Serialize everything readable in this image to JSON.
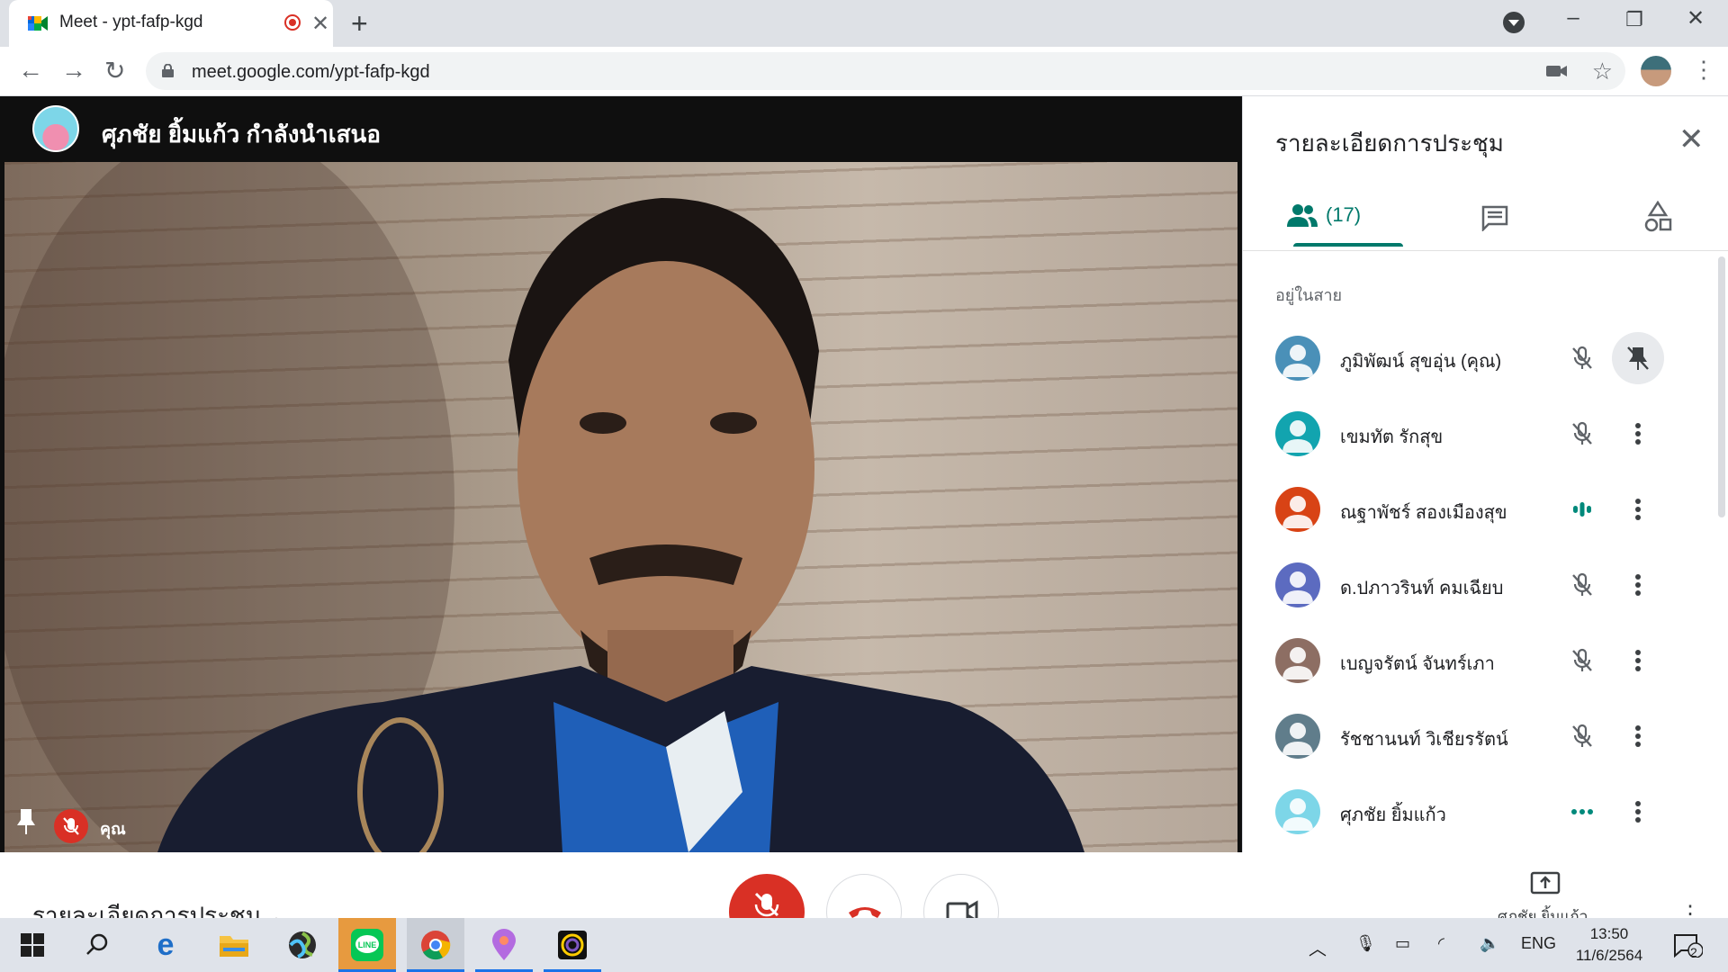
{
  "browser": {
    "tab_title": "Meet - ypt-fafp-kgd",
    "url": "meet.google.com/ypt-fafp-kgd"
  },
  "stage": {
    "presenter_title": "ศุภชัย ยิ้มแก้ว กำลังนำเสนอ",
    "self_label": "คุณ"
  },
  "panel": {
    "title": "รายละเอียดการประชุม",
    "people_count": "(17)",
    "section_label": "อยู่ในสาย",
    "participants": [
      {
        "name": "ภูมิพัฒน์ สุขอุ่น (คุณ)",
        "avatar_color": "#4a90b8",
        "mic": "muted",
        "action": "pinned"
      },
      {
        "name": "เขมทัต รักสุข",
        "avatar_color": "#12a4af",
        "mic": "muted",
        "action": "more"
      },
      {
        "name": "ณฐาพัชร์ สองเมืองสุข",
        "avatar_color": "#d84315",
        "mic": "speaking",
        "action": "more"
      },
      {
        "name": "ด.ปภาวรินท์ คมเฉียบ",
        "avatar_color": "#5c6bc0",
        "mic": "muted",
        "action": "more"
      },
      {
        "name": "เบญจรัตน์ จันทร์เภา",
        "avatar_color": "#8d6e63",
        "mic": "muted",
        "action": "more"
      },
      {
        "name": "รัชชานนท์ วิเชียรรัตน์",
        "avatar_color": "#607d8b",
        "mic": "muted",
        "action": "more"
      },
      {
        "name": "ศุภชัย ยิ้มแก้ว",
        "avatar_color": "#7dd6e8",
        "mic": "active-dots",
        "action": "more"
      }
    ]
  },
  "bottom": {
    "meeting_details": "รายละเอียดการประชุม",
    "present_label": "ศุภชัย ยิ้มแก้ว"
  },
  "taskbar": {
    "language": "ENG",
    "time": "13:50",
    "date": "11/6/2564",
    "notification_count": "2"
  },
  "colors": {
    "accent": "#00796b",
    "danger": "#d93025"
  }
}
